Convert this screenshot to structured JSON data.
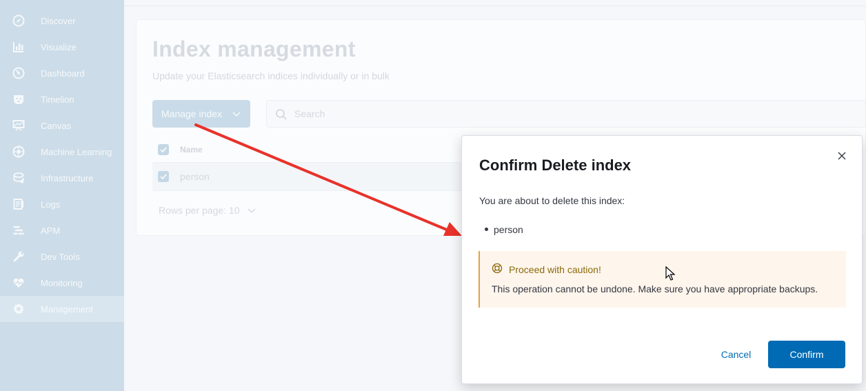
{
  "sidebar": {
    "items": [
      {
        "label": "Discover",
        "icon": "compass-icon"
      },
      {
        "label": "Visualize",
        "icon": "chart-icon"
      },
      {
        "label": "Dashboard",
        "icon": "dashboard-icon"
      },
      {
        "label": "Timelion",
        "icon": "timelion-icon"
      },
      {
        "label": "Canvas",
        "icon": "canvas-icon"
      },
      {
        "label": "Machine Learning",
        "icon": "machine-learning-icon"
      },
      {
        "label": "Infrastructure",
        "icon": "infrastructure-icon"
      },
      {
        "label": "Logs",
        "icon": "logs-icon"
      },
      {
        "label": "APM",
        "icon": "apm-icon"
      },
      {
        "label": "Dev Tools",
        "icon": "wrench-icon"
      },
      {
        "label": "Monitoring",
        "icon": "heartbeat-icon"
      },
      {
        "label": "Management",
        "icon": "gear-icon",
        "active": true
      }
    ]
  },
  "main": {
    "title": "Index management",
    "subtitle": "Update your Elasticsearch indices individually or in bulk",
    "manage_button": "Manage index",
    "search_placeholder": "Search",
    "table": {
      "column_name": "Name",
      "rows": [
        {
          "name": "person",
          "checked": true
        }
      ]
    },
    "rows_per_page": "Rows per page: 10"
  },
  "modal": {
    "title": "Confirm Delete index",
    "intro": "You are about to delete this index:",
    "indices": [
      "person"
    ],
    "callout_title": "Proceed with caution!",
    "callout_text": "This operation cannot be undone. Make sure you have appropriate backups.",
    "cancel_label": "Cancel",
    "confirm_label": "Confirm"
  },
  "colors": {
    "primary": "#006bb4",
    "warning": "#e3a33b",
    "annotation_arrow": "#e8322a"
  }
}
